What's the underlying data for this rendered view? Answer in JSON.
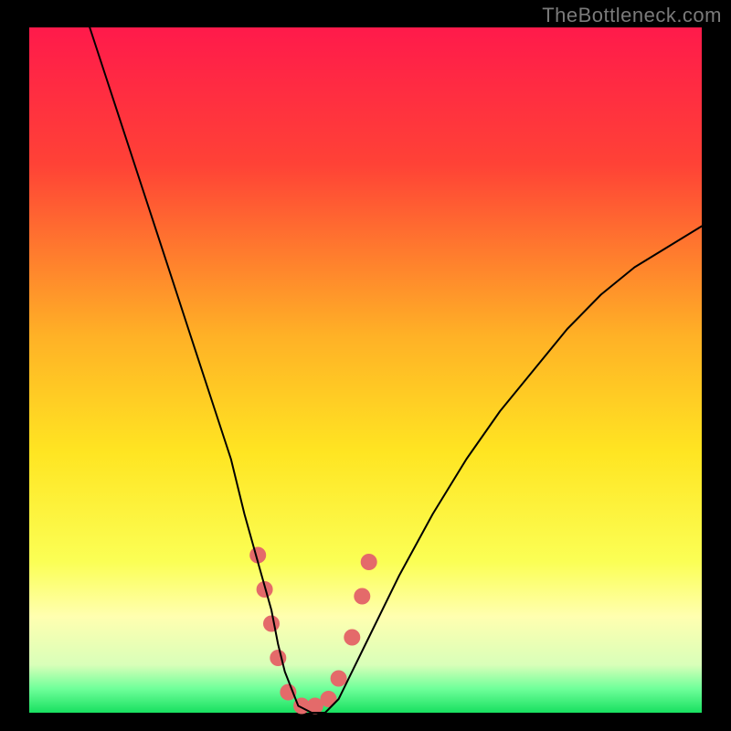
{
  "watermark": "TheBottleneck.com",
  "chart_data": {
    "type": "line",
    "title": "",
    "xlabel": "",
    "ylabel": "",
    "xlim": [
      0,
      100
    ],
    "ylim": [
      0,
      100
    ],
    "grid": false,
    "legend": false,
    "background_gradient": {
      "direction": "vertical",
      "stops": [
        {
          "pos": 0.0,
          "color": "#ff1a4b"
        },
        {
          "pos": 0.2,
          "color": "#ff4236"
        },
        {
          "pos": 0.45,
          "color": "#ffb126"
        },
        {
          "pos": 0.62,
          "color": "#ffe522"
        },
        {
          "pos": 0.78,
          "color": "#fbff55"
        },
        {
          "pos": 0.86,
          "color": "#ffffb0"
        },
        {
          "pos": 0.93,
          "color": "#d9ffb9"
        },
        {
          "pos": 0.965,
          "color": "#6fff9a"
        },
        {
          "pos": 1.0,
          "color": "#18e060"
        }
      ]
    },
    "series": [
      {
        "name": "bottleneck-curve",
        "stroke": "#000000",
        "stroke_width": 2,
        "x": [
          9,
          12,
          15,
          18,
          21,
          24,
          27,
          30,
          32,
          34,
          36,
          37,
          38,
          40,
          42,
          44,
          46,
          50,
          55,
          60,
          65,
          70,
          75,
          80,
          85,
          90,
          95,
          100
        ],
        "y": [
          100,
          91,
          82,
          73,
          64,
          55,
          46,
          37,
          29,
          22,
          15,
          10,
          6,
          1,
          0,
          0,
          2,
          10,
          20,
          29,
          37,
          44,
          50,
          56,
          61,
          65,
          68,
          71
        ]
      }
    ],
    "markers": {
      "name": "highlight-dots",
      "color": "#e46a6a",
      "radius_px": 9,
      "points": [
        {
          "x": 34.0,
          "y": 23
        },
        {
          "x": 35.0,
          "y": 18
        },
        {
          "x": 36.0,
          "y": 13
        },
        {
          "x": 37.0,
          "y": 8
        },
        {
          "x": 38.5,
          "y": 3
        },
        {
          "x": 40.5,
          "y": 1
        },
        {
          "x": 42.5,
          "y": 1
        },
        {
          "x": 44.5,
          "y": 2
        },
        {
          "x": 46.0,
          "y": 5
        },
        {
          "x": 48.0,
          "y": 11
        },
        {
          "x": 49.5,
          "y": 17
        },
        {
          "x": 50.5,
          "y": 22
        }
      ]
    }
  }
}
